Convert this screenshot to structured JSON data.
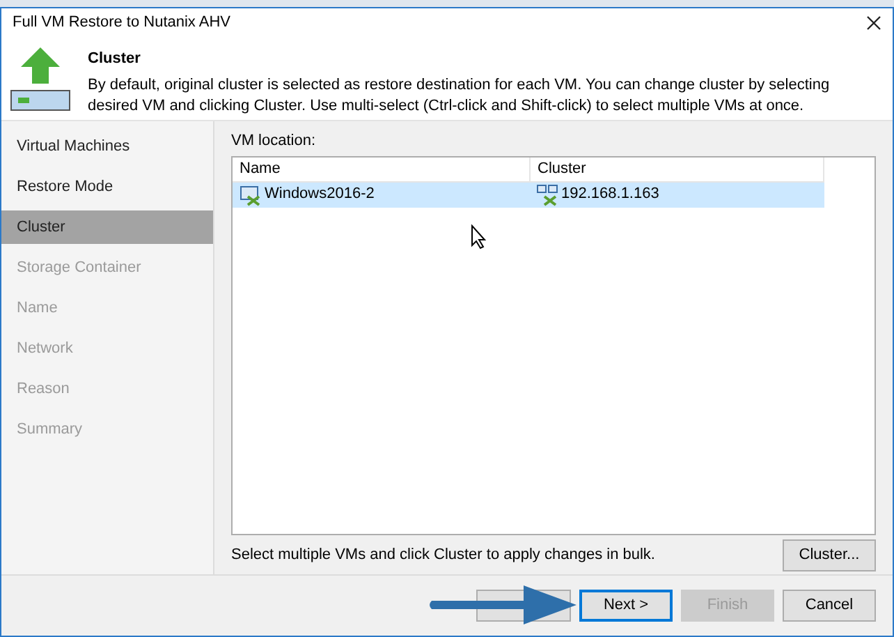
{
  "window": {
    "title": "Full VM Restore to Nutanix AHV"
  },
  "header": {
    "title": "Cluster",
    "description": "By default, original cluster is selected as restore destination for each VM. You can change cluster by selecting desired VM and clicking Cluster. Use multi-select (Ctrl-click and Shift-click) to select multiple VMs at once."
  },
  "steps": [
    {
      "label": "Virtual Machines",
      "selected": false,
      "disabled": false
    },
    {
      "label": "Restore Mode",
      "selected": false,
      "disabled": false
    },
    {
      "label": "Cluster",
      "selected": true,
      "disabled": false
    },
    {
      "label": "Storage Container",
      "selected": false,
      "disabled": true
    },
    {
      "label": "Name",
      "selected": false,
      "disabled": true
    },
    {
      "label": "Network",
      "selected": false,
      "disabled": true
    },
    {
      "label": "Reason",
      "selected": false,
      "disabled": true
    },
    {
      "label": "Summary",
      "selected": false,
      "disabled": true
    }
  ],
  "vm_location": {
    "label": "VM location:",
    "columns": [
      "Name",
      "Cluster"
    ],
    "rows": [
      {
        "name": "Windows2016-2",
        "cluster": "192.168.1.163",
        "selected": true
      }
    ]
  },
  "hint": "Select multiple VMs and click Cluster to apply changes in bulk.",
  "cluster_button": "Cluster...",
  "buttons": [
    {
      "label": "Next >",
      "disabled": false,
      "focused": true
    },
    {
      "label": "Finish",
      "disabled": true,
      "focused": false
    },
    {
      "label": "Cancel",
      "disabled": false,
      "focused": false
    }
  ]
}
